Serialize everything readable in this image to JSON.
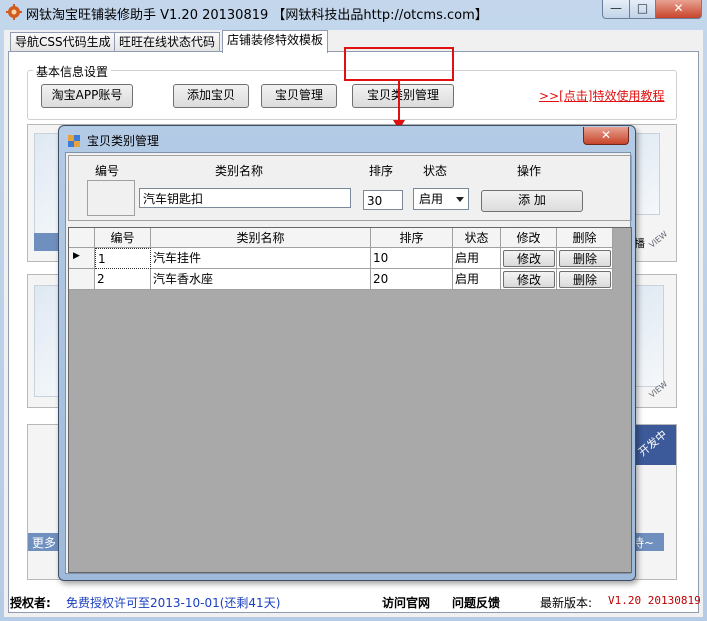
{
  "window": {
    "title": "网钛淘宝旺铺装修助手 V1.20 20130819 【网钛科技出品http://otcms.com】",
    "min_label": "—",
    "max_label": "□",
    "close_label": "✕"
  },
  "tabs": [
    {
      "label": "导航CSS代码生成"
    },
    {
      "label": "旺旺在线状态代码"
    },
    {
      "label": "店铺装修特效模板"
    }
  ],
  "basic_info": {
    "group_label": "基本信息设置",
    "buttons": {
      "taobao_app": "淘宝APP账号",
      "add_item": "添加宝贝",
      "item_manage": "宝贝管理",
      "category_manage": "宝贝类别管理"
    },
    "tutorial_link": ">>[点击]特效使用教程"
  },
  "background_labels": {
    "more": "更多",
    "wait": "待~",
    "dev": "开发中",
    "play": "播",
    "view": "VIEW"
  },
  "dialog": {
    "title": "宝贝类别管理",
    "close_label": "✕",
    "form": {
      "headers": {
        "id": "编号",
        "name": "类别名称",
        "sort": "排序",
        "status": "状态",
        "action": "操作"
      },
      "name_value": "汽车钥匙扣",
      "sort_value": "30",
      "status_value": "启用",
      "add_button": "添 加"
    },
    "grid": {
      "columns": [
        "编号",
        "类别名称",
        "排序",
        "状态",
        "修改",
        "删除"
      ],
      "rows": [
        {
          "id": "1",
          "name": "汽车挂件",
          "sort": "10",
          "status": "启用",
          "edit": "修改",
          "delete": "删除"
        },
        {
          "id": "2",
          "name": "汽车香水座",
          "sort": "20",
          "status": "启用",
          "edit": "修改",
          "delete": "删除"
        }
      ],
      "current_row_marker": "▶"
    }
  },
  "statusbar": {
    "license_label": "授权者:",
    "license_text": "免费授权许可至2013-10-01(还剩41天)",
    "visit_site": "访问官网",
    "feedback": "问题反馈",
    "latest_label": "最新版本:",
    "latest_version": "V1.20 20130819"
  },
  "colors": {
    "accent_red": "#e01010",
    "license_blue": "#1a3fc0",
    "version_red": "#c00000"
  }
}
